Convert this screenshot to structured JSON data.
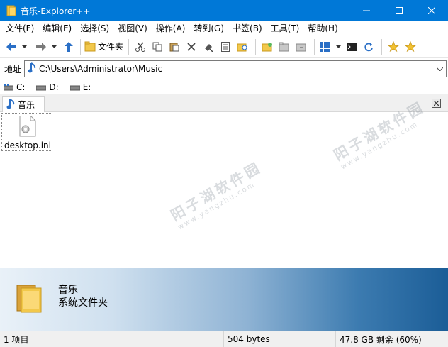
{
  "window": {
    "title": "音乐-Explorer++"
  },
  "menu": [
    "文件(F)",
    "编辑(E)",
    "选择(S)",
    "视图(V)",
    "操作(A)",
    "转到(G)",
    "书签(B)",
    "工具(T)",
    "帮助(H)"
  ],
  "toolbar": {
    "folders_label": "文件夹"
  },
  "address": {
    "label": "地址",
    "path": "C:\\Users\\Administrator\\Music"
  },
  "drives": [
    "C:",
    "D:",
    "E:"
  ],
  "tab": {
    "label": "音乐"
  },
  "files": [
    {
      "name": "desktop.ini"
    }
  ],
  "info": {
    "name": "音乐",
    "type": "系统文件夹"
  },
  "status": {
    "items": "1 项目",
    "size": "504 bytes",
    "free": "47.8 GB 剩余 (60%)"
  },
  "watermark": {
    "text": "阳子湖软件园",
    "url": "www.yangzhu.com"
  },
  "colors": {
    "titlebar": "#0078d7",
    "accent_blue": "#2a6fc6",
    "folder_yellow": "#e8b84a"
  }
}
